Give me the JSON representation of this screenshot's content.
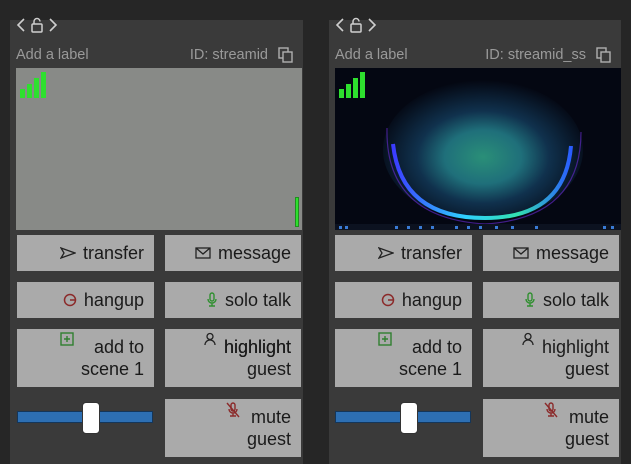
{
  "panels": [
    {
      "add_label": "Add a label",
      "stream_id": "ID: streamid",
      "video": "blank",
      "buttons": {
        "transfer": "transfer",
        "message": "message",
        "hangup": "hangup",
        "solo_talk": "solo talk",
        "add_to_scene_1": "add to",
        "add_to_scene_2": "scene 1",
        "highlight_1": "highlight",
        "highlight_2": "guest",
        "mute_1": "mute",
        "mute_2": "guest"
      },
      "volume_level": 0.55
    },
    {
      "add_label": "Add a label",
      "stream_id": "ID: streamid_ss",
      "video": "screen-share-desktop",
      "buttons": {
        "transfer": "transfer",
        "message": "message",
        "hangup": "hangup",
        "solo_talk": "solo talk",
        "add_to_scene_1": "add to",
        "add_to_scene_2": "scene 1",
        "highlight_1": "highlight",
        "highlight_2": "guest",
        "mute_1": "mute",
        "mute_2": "guest"
      },
      "volume_level": 0.55
    }
  ],
  "colors": {
    "panel_bg": "#3a3a3a",
    "button_bg": "#aaaaaa",
    "signal_green": "#2ee02e",
    "slider_blue": "#2d6fb3",
    "hangup_red": "#8b2a2a",
    "solo_green": "#2f8f2f",
    "highlight_yellow": "#e8e800"
  },
  "icons": {
    "nav_left": "chevron-left-icon",
    "nav_lock": "lock-icon",
    "nav_right": "chevron-right-icon",
    "copy": "copy-icon",
    "signal": "signal-bars-icon",
    "transfer": "send-icon",
    "message": "envelope-icon",
    "hangup": "hangup-icon",
    "solo_talk": "microphone-icon",
    "add_to_scene": "plus-square-icon",
    "highlight": "person-icon",
    "mute": "microphone-off-icon"
  }
}
